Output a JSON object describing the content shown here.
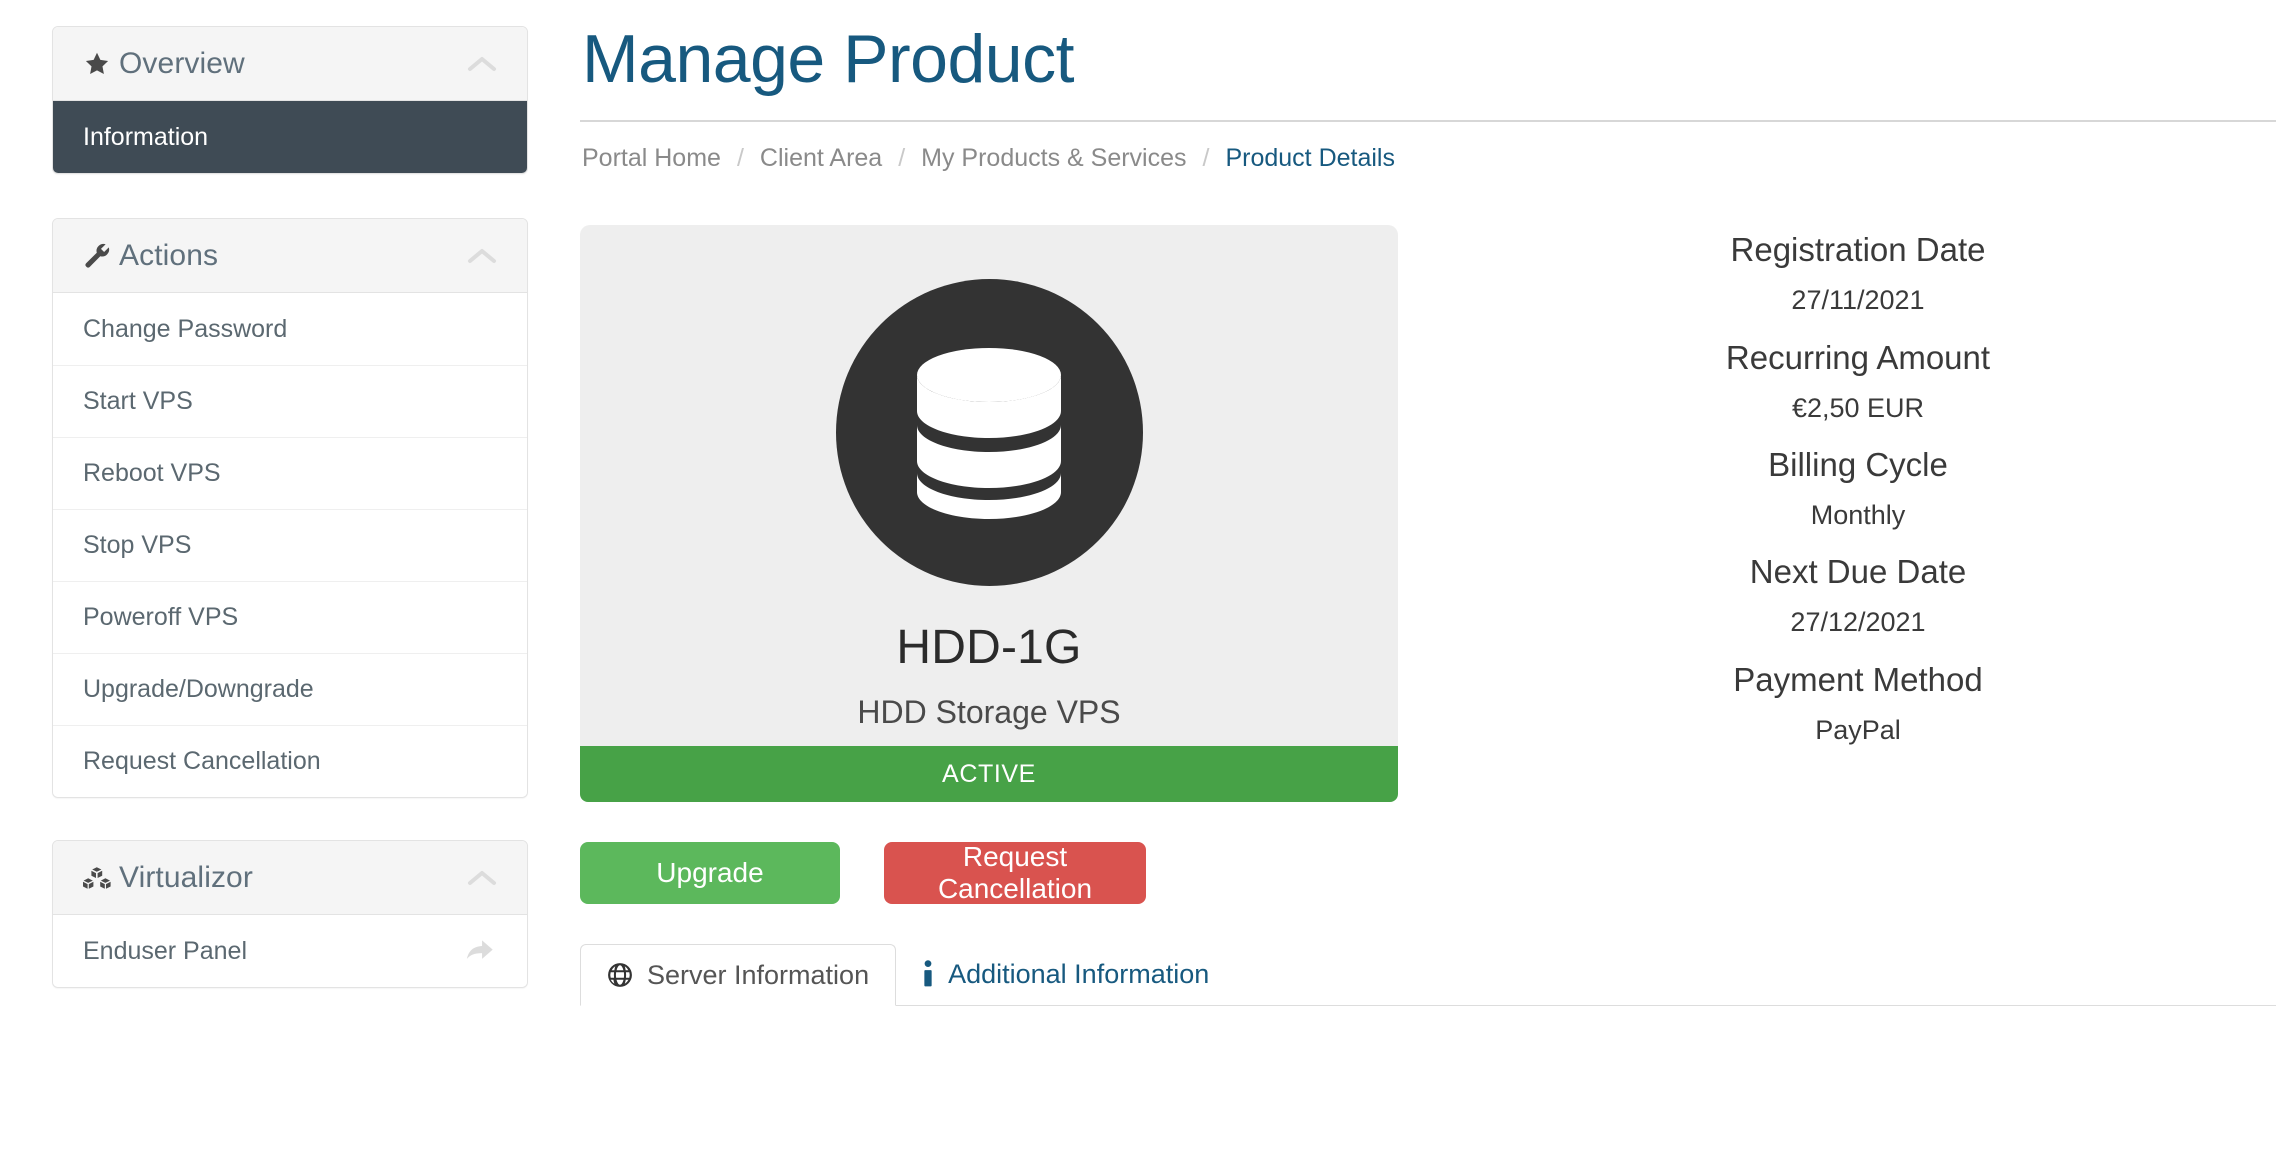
{
  "sidebar": {
    "panels": [
      {
        "id": "overview",
        "icon": "star-icon",
        "title": "Overview",
        "chevron": "chevron-up-icon",
        "active_item": "Information"
      },
      {
        "id": "actions",
        "icon": "wrench-icon",
        "title": "Actions",
        "chevron": "chevron-up-icon",
        "items": [
          "Change Password",
          "Start VPS",
          "Reboot VPS",
          "Stop VPS",
          "Poweroff VPS",
          "Upgrade/Downgrade",
          "Request Cancellation"
        ]
      },
      {
        "id": "virtualizor",
        "icon": "cubes-icon",
        "title": "Virtualizor",
        "chevron": "chevron-up-icon",
        "items": [
          "Enduser Panel"
        ],
        "item_trailing_icon": "external-share-icon"
      }
    ]
  },
  "header": {
    "title": "Manage Product",
    "breadcrumb": [
      {
        "label": "Portal Home",
        "current": false
      },
      {
        "label": "Client Area",
        "current": false
      },
      {
        "label": "My Products & Services",
        "current": false
      },
      {
        "label": "Product Details",
        "current": true
      }
    ],
    "breadcrumb_separator": "/"
  },
  "product": {
    "icon": "database-icon",
    "name": "HDD-1G",
    "description": "HDD Storage VPS",
    "status": "ACTIVE",
    "status_color": "#47a247"
  },
  "buttons": {
    "upgrade": "Upgrade",
    "request_cancellation": "Request Cancellation",
    "upgrade_color": "#5cb85c",
    "cancel_color": "#d9534f"
  },
  "tabs": [
    {
      "label": "Server Information",
      "icon": "globe-icon",
      "active": true
    },
    {
      "label": "Additional Information",
      "icon": "info-icon",
      "active": false
    }
  ],
  "details": [
    {
      "label": "Registration Date",
      "value": "27/11/2021"
    },
    {
      "label": "Recurring Amount",
      "value": "€2,50 EUR"
    },
    {
      "label": "Billing Cycle",
      "value": "Monthly"
    },
    {
      "label": "Next Due Date",
      "value": "27/12/2021"
    },
    {
      "label": "Payment Method",
      "value": "PayPal"
    }
  ]
}
